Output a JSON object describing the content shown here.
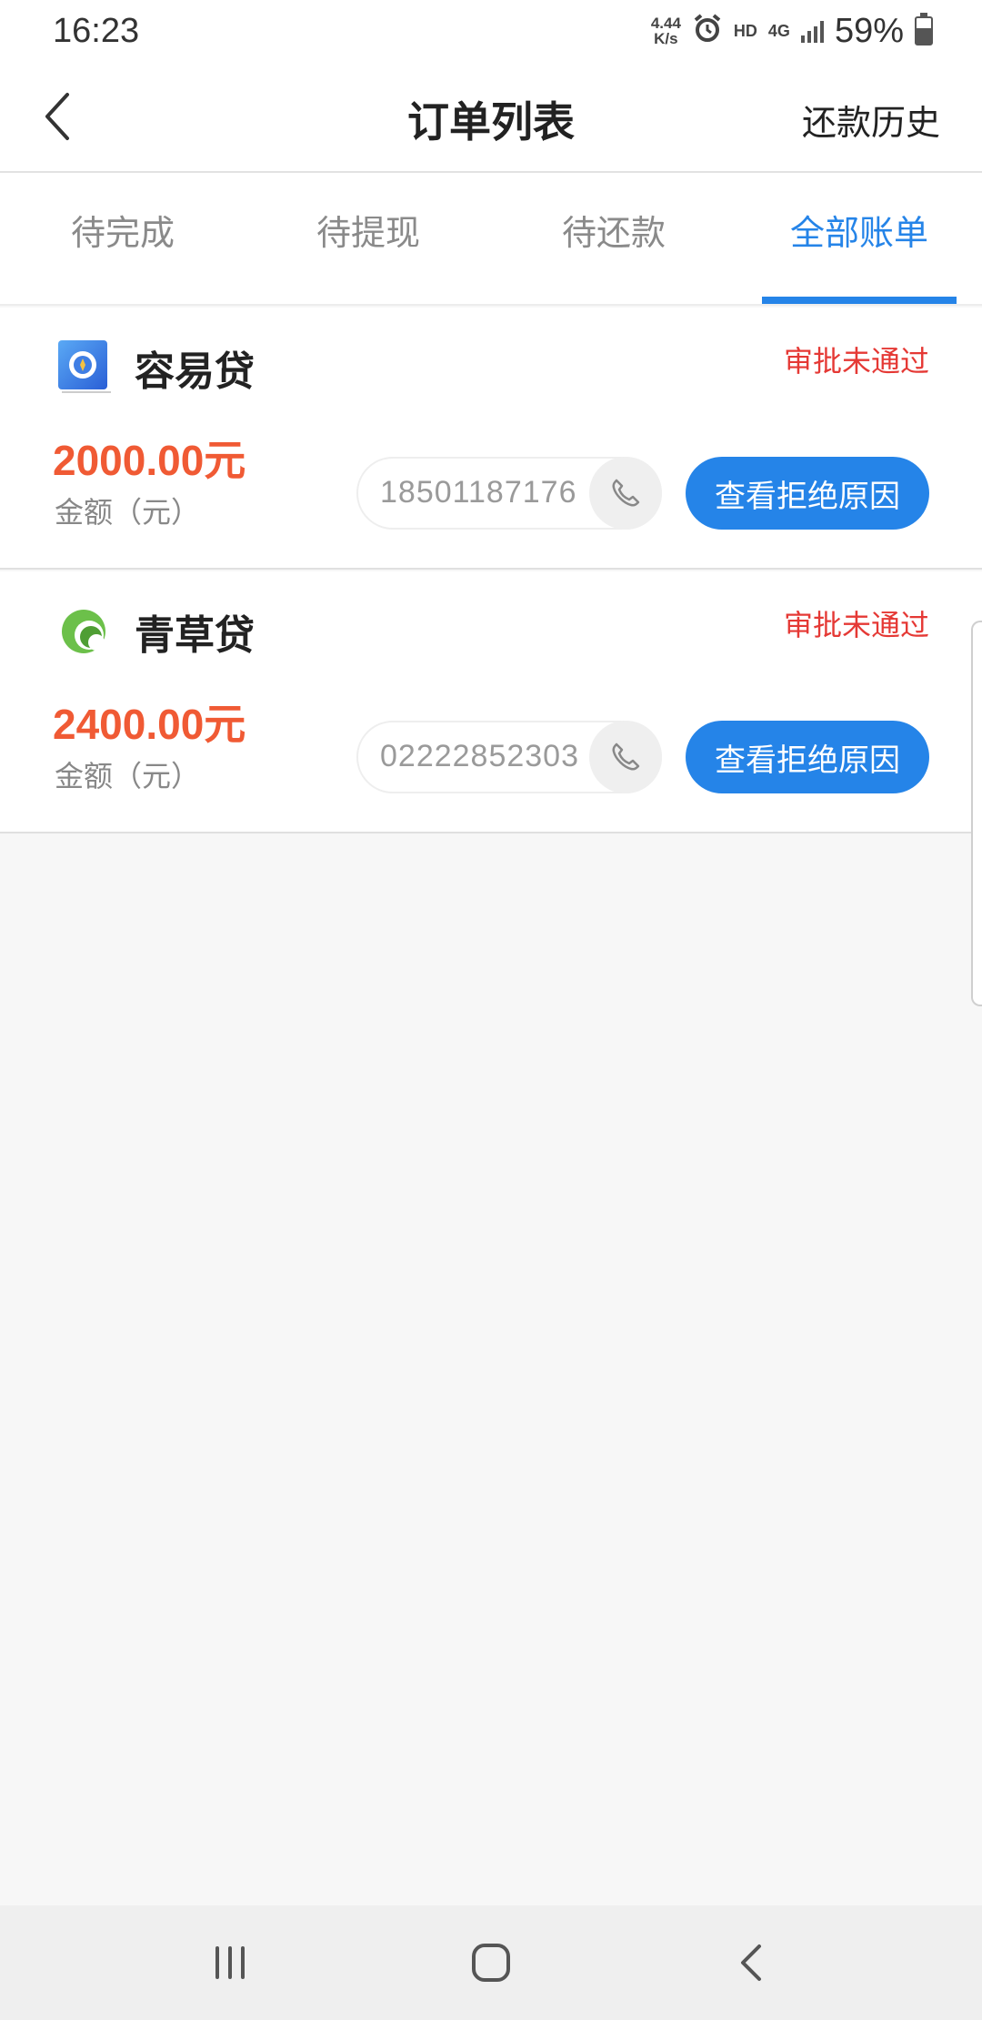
{
  "status_bar": {
    "time": "16:23",
    "net_speed_value": "4.44",
    "net_speed_unit": "K/s",
    "hd_label": "HD",
    "network_label": "4G",
    "battery_percent": "59%",
    "battery_level": 0.59,
    "icons": [
      "alarm-icon",
      "signal-icon",
      "battery-icon"
    ]
  },
  "header": {
    "title": "订单列表",
    "right_action": "还款历史",
    "back_icon": "chevron-left-icon"
  },
  "tabs": [
    {
      "label": "待完成",
      "active": false
    },
    {
      "label": "待提现",
      "active": false
    },
    {
      "label": "待还款",
      "active": false
    },
    {
      "label": "全部账单",
      "active": true
    }
  ],
  "orders": [
    {
      "lender": "容易贷",
      "status": "审批未通过",
      "amount": "2000.00元",
      "amount_label": "金额（元）",
      "phone": "18501187176",
      "action": "查看拒绝原因",
      "logo_icon": "rongyidai-logo-icon"
    },
    {
      "lender": "青草贷",
      "status": "审批未通过",
      "amount": "2400.00元",
      "amount_label": "金额（元）",
      "phone": "02222852303",
      "action": "查看拒绝原因",
      "logo_icon": "qingcaodai-logo-icon"
    }
  ],
  "colors": {
    "accent": "#2584e8",
    "status_red": "#e53935",
    "amount_orange": "#f05a34"
  },
  "nav_bar": {
    "icons": [
      "recent-apps-icon",
      "home-icon",
      "back-icon"
    ]
  }
}
